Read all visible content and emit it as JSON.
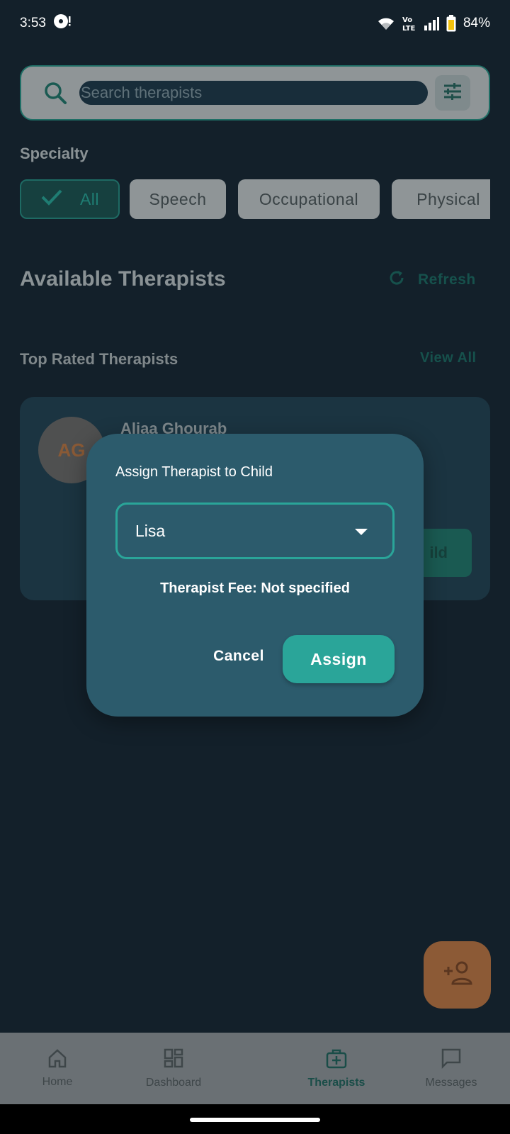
{
  "status_bar": {
    "time": "3:53",
    "battery": "84%",
    "icons": [
      "media-icon",
      "wifi-icon",
      "volte-icon",
      "signal-icon",
      "battery-icon"
    ]
  },
  "search": {
    "placeholder": "Search therapists",
    "icon": "search-icon",
    "filter_icon": "tune-icon"
  },
  "specialty": {
    "label": "Specialty",
    "chips": [
      {
        "label": "All",
        "selected": true
      },
      {
        "label": "Speech",
        "selected": false
      },
      {
        "label": "Occupational",
        "selected": false
      },
      {
        "label": "Physical",
        "selected": false
      }
    ]
  },
  "available": {
    "title": "Available Therapists",
    "refresh_label": "Refresh"
  },
  "top_rated": {
    "title": "Top Rated Therapists",
    "view_all_label": "View All"
  },
  "card": {
    "initials": "AG",
    "name": "Aliaa Ghourab",
    "button_label": "Assign to Child",
    "button_visible_text": "ild"
  },
  "dialog": {
    "title": "Assign Therapist to Child",
    "selected_child": "Lisa",
    "fee_text": "Therapist Fee: Not specified",
    "cancel_label": "Cancel",
    "assign_label": "Assign"
  },
  "fab": {
    "icon": "add-person-icon"
  },
  "bottom_nav": {
    "items": [
      {
        "label": "Home",
        "icon": "home-icon",
        "active": false
      },
      {
        "label": "Dashboard",
        "icon": "dashboard-icon",
        "active": false
      },
      {
        "label": "Therapists",
        "icon": "medical-bag-icon",
        "active": true
      },
      {
        "label": "Messages",
        "icon": "message-icon",
        "active": false
      }
    ]
  },
  "colors": {
    "background": "#13202a",
    "dialog": "#2c5b6c",
    "accent": "#2aa599",
    "fab": "#8c5a36"
  }
}
